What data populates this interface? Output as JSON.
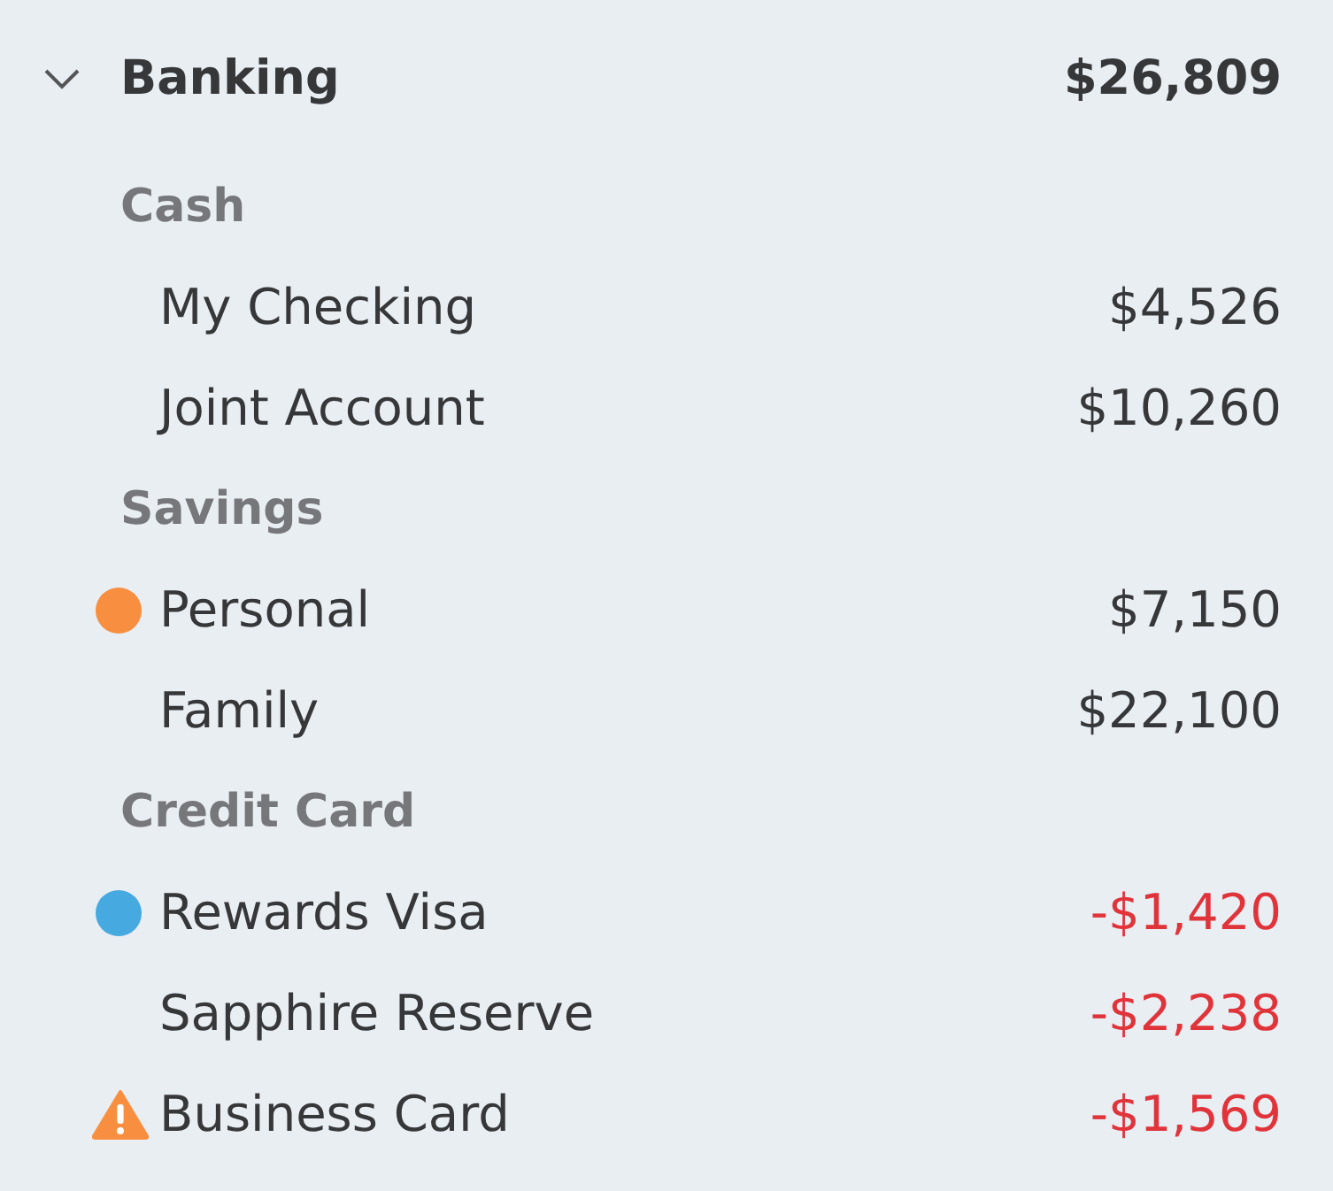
{
  "group": {
    "name": "Banking",
    "total": "$26,809",
    "expanded": true
  },
  "categories": [
    {
      "name": "Cash",
      "accounts": [
        {
          "name": "My Checking",
          "amount": "$4,526",
          "negative": false,
          "kind": "plain"
        },
        {
          "name": "Joint Account",
          "amount": "$10,260",
          "negative": false,
          "kind": "plain"
        }
      ]
    },
    {
      "name": "Savings",
      "accounts": [
        {
          "name": "Personal",
          "amount": "$7,150",
          "negative": false,
          "kind": "dot",
          "color": "#f88f40"
        },
        {
          "name": "Family",
          "amount": "$22,100",
          "negative": false,
          "kind": "plain"
        }
      ]
    },
    {
      "name": "Credit Card",
      "accounts": [
        {
          "name": "Rewards Visa",
          "amount": "-$1,420",
          "negative": true,
          "kind": "dot",
          "color": "#46a9e0"
        },
        {
          "name": "Sapphire Reserve",
          "amount": "-$2,238",
          "negative": true,
          "kind": "plain"
        },
        {
          "name": "Business Card",
          "amount": "-$1,569",
          "negative": true,
          "kind": "warning"
        }
      ]
    }
  ]
}
